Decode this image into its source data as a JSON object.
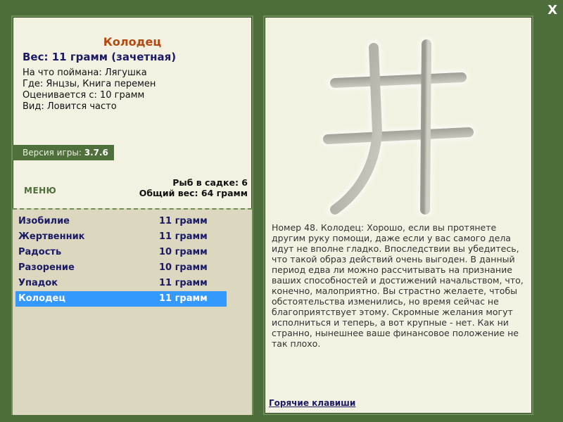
{
  "window": {
    "close_glyph": "X"
  },
  "fish": {
    "title": "Колодец",
    "weight_line": "Вес: 11 грамм (зачетная)",
    "details": [
      "На что поймана: Лягушка",
      "Где: Янцзы, Книга перемен",
      "Оценивается с: 10 грамм",
      "Вид: Ловится часто"
    ]
  },
  "version": {
    "label": "Версия игры:",
    "value": "3.7.6"
  },
  "menu": {
    "label": "МЕНЮ"
  },
  "stats": {
    "fish_count": "Рыб в садке: 6",
    "total_weight": "Общий вес: 64 грамм"
  },
  "fish_list": [
    {
      "name": "Изобилие",
      "weight": "11 грамм",
      "selected": false
    },
    {
      "name": "Жертвенник",
      "weight": "11 грамм",
      "selected": false
    },
    {
      "name": "Радость",
      "weight": "10 грамм",
      "selected": false
    },
    {
      "name": "Разорение",
      "weight": "10 грамм",
      "selected": false
    },
    {
      "name": "Упадок",
      "weight": "11 грамм",
      "selected": false
    },
    {
      "name": "Колодец",
      "weight": "11 грамм",
      "selected": true
    }
  ],
  "right": {
    "kanji_icon": "well-kanji-icon",
    "description": "Номер 48. Колодец: Хорошо, если вы протянете другим руку помощи, даже если у вас самого дела идут не вполне гладко. Впоследствии вы убедитесь, что такой образ действий очень выгоден. В данный период едва ли можно рассчитывать на признание ваших способностей и достижений начальством, что, конечно, малоприятно. Вы страстно желаете, чтобы обстоятельства изменились, но время сейчас не благоприятствует этому. Скромные желания могут исполниться и теперь, а вот крупные - нет. Как ни странно, нынешнее ваше финансовое положение не так плохо.",
    "hotkeys": "Горячие клавиши"
  }
}
